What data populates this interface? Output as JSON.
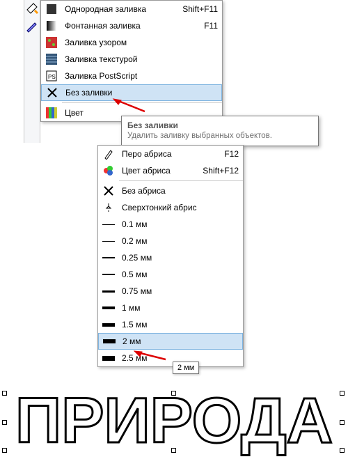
{
  "menu1": {
    "items": [
      {
        "label": "Однородная заливка",
        "shortcut": "Shift+F11"
      },
      {
        "label": "Фонтанная заливка",
        "shortcut": "F11"
      },
      {
        "label": "Заливка узором",
        "shortcut": ""
      },
      {
        "label": "Заливка текстурой",
        "shortcut": ""
      },
      {
        "label": "Заливка PostScript",
        "shortcut": ""
      },
      {
        "label": "Без заливки",
        "shortcut": ""
      },
      {
        "label": "Цвет",
        "shortcut": ""
      }
    ]
  },
  "tooltip": {
    "title": "Без заливки",
    "desc": "Удалить заливку выбранных объектов."
  },
  "menu2": {
    "items": [
      {
        "label": "Перо абриса",
        "shortcut": "F12"
      },
      {
        "label": "Цвет абриса",
        "shortcut": "Shift+F12"
      },
      {
        "label": "Без абриса",
        "shortcut": ""
      },
      {
        "label": "Сверхтонкий абрис",
        "shortcut": ""
      },
      {
        "label": "0.1 мм",
        "shortcut": ""
      },
      {
        "label": "0.2 мм",
        "shortcut": ""
      },
      {
        "label": "0.25 мм",
        "shortcut": ""
      },
      {
        "label": "0.5 мм",
        "shortcut": ""
      },
      {
        "label": "0.75 мм",
        "shortcut": ""
      },
      {
        "label": "1 мм",
        "shortcut": ""
      },
      {
        "label": "1.5 мм",
        "shortcut": ""
      },
      {
        "label": "2 мм",
        "shortcut": ""
      },
      {
        "label": "2.5 мм",
        "shortcut": ""
      }
    ]
  },
  "mini_tip": "2 мм",
  "sample_text": "ПРИРОДА"
}
